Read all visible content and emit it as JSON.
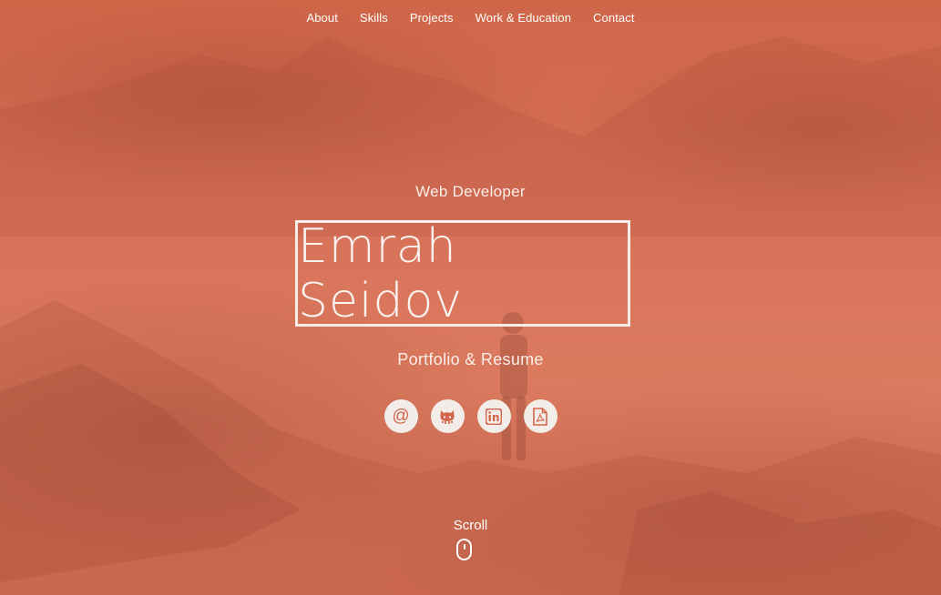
{
  "nav": {
    "items": [
      {
        "label": "About"
      },
      {
        "label": "Skills"
      },
      {
        "label": "Projects"
      },
      {
        "label": "Work & Education"
      },
      {
        "label": "Contact"
      }
    ]
  },
  "hero": {
    "subtitle": "Web Developer",
    "name": "Emrah Seidov",
    "tagline": "Portfolio & Resume",
    "socials": [
      {
        "icon": "at-sign-icon",
        "glyph": "@"
      },
      {
        "icon": "github-icon"
      },
      {
        "icon": "linkedin-icon"
      },
      {
        "icon": "pdf-icon"
      }
    ],
    "scroll_label": "Scroll"
  },
  "colors": {
    "accent": "#d96c4d",
    "text": "#ffffff",
    "button_bg": "#f3ede9"
  }
}
